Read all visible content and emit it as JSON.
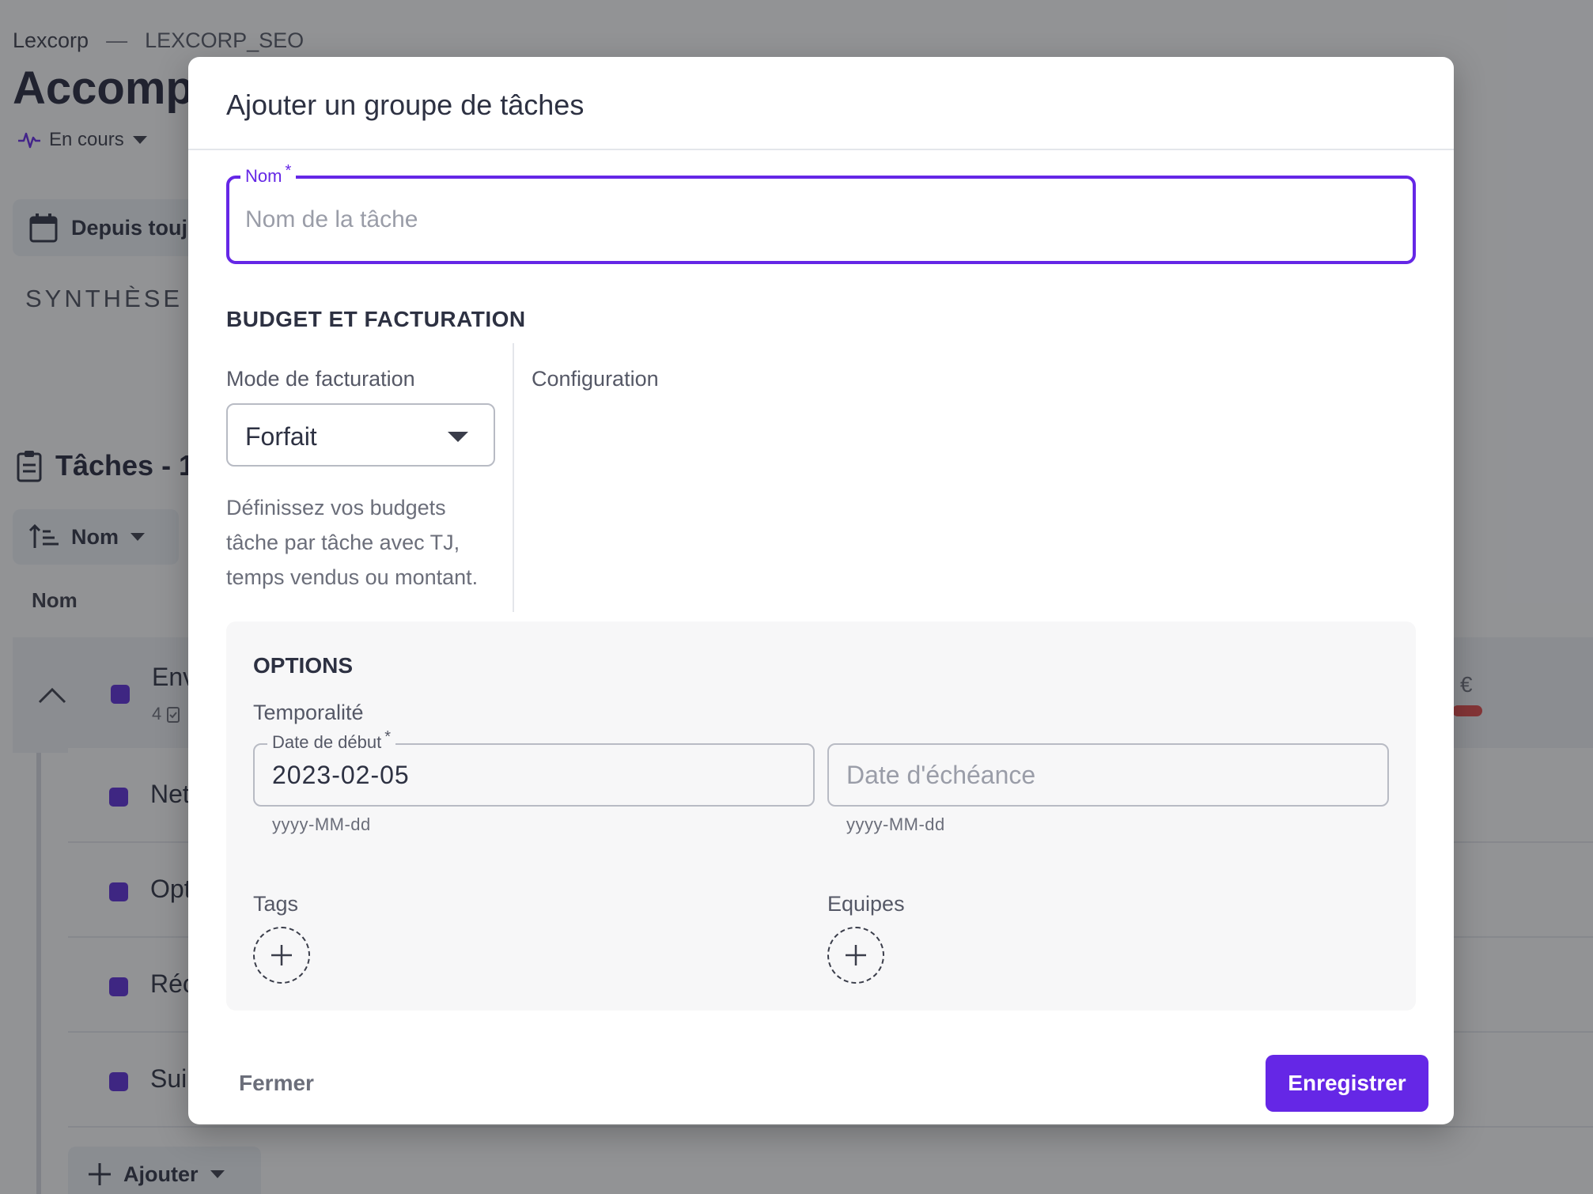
{
  "background": {
    "breadcrumb": {
      "org": "Lexcorp",
      "separator": "—",
      "project": "LEXCORP_SEO"
    },
    "title": "Accompa",
    "status": {
      "label": "En cours"
    },
    "date_filter": {
      "label": "Depuis touj"
    },
    "synthese": "SYNTHÈSE",
    "tasks_heading": "Tâches - 1",
    "sort": {
      "label": "Nom"
    },
    "column_header": "Nom",
    "group_row": {
      "label": "Env",
      "count": "4",
      "amount": "€"
    },
    "child_rows": [
      "Net",
      "Opt",
      "Réc",
      "Sui"
    ],
    "add_button": "Ajouter"
  },
  "modal": {
    "title": "Ajouter un groupe de tâches",
    "nom_field": {
      "label": "Nom",
      "required_mark": "*",
      "placeholder": "Nom de la tâche",
      "value": ""
    },
    "budget_section": {
      "title": "BUDGET ET FACTURATION",
      "mode_label": "Mode de facturation",
      "mode_value": "Forfait",
      "mode_help": "Définissez vos budgets tâche par tâche avec TJ, temps vendus ou montant.",
      "config_label": "Configuration"
    },
    "options": {
      "title": "OPTIONS",
      "temporalite_label": "Temporalité",
      "start_date": {
        "label": "Date de début",
        "required_mark": "*",
        "value": "2023-02-05",
        "hint": "yyyy-MM-dd"
      },
      "end_date": {
        "placeholder": "Date d'échéance",
        "hint": "yyyy-MM-dd"
      },
      "tags_label": "Tags",
      "teams_label": "Equipes"
    },
    "footer": {
      "close_label": "Fermer",
      "save_label": "Enregistrer"
    }
  },
  "colors": {
    "accent": "#6527e6",
    "overlay": "rgba(32,33,38,0.48)",
    "task_square": "#5b2bd6",
    "danger": "#e04848"
  }
}
